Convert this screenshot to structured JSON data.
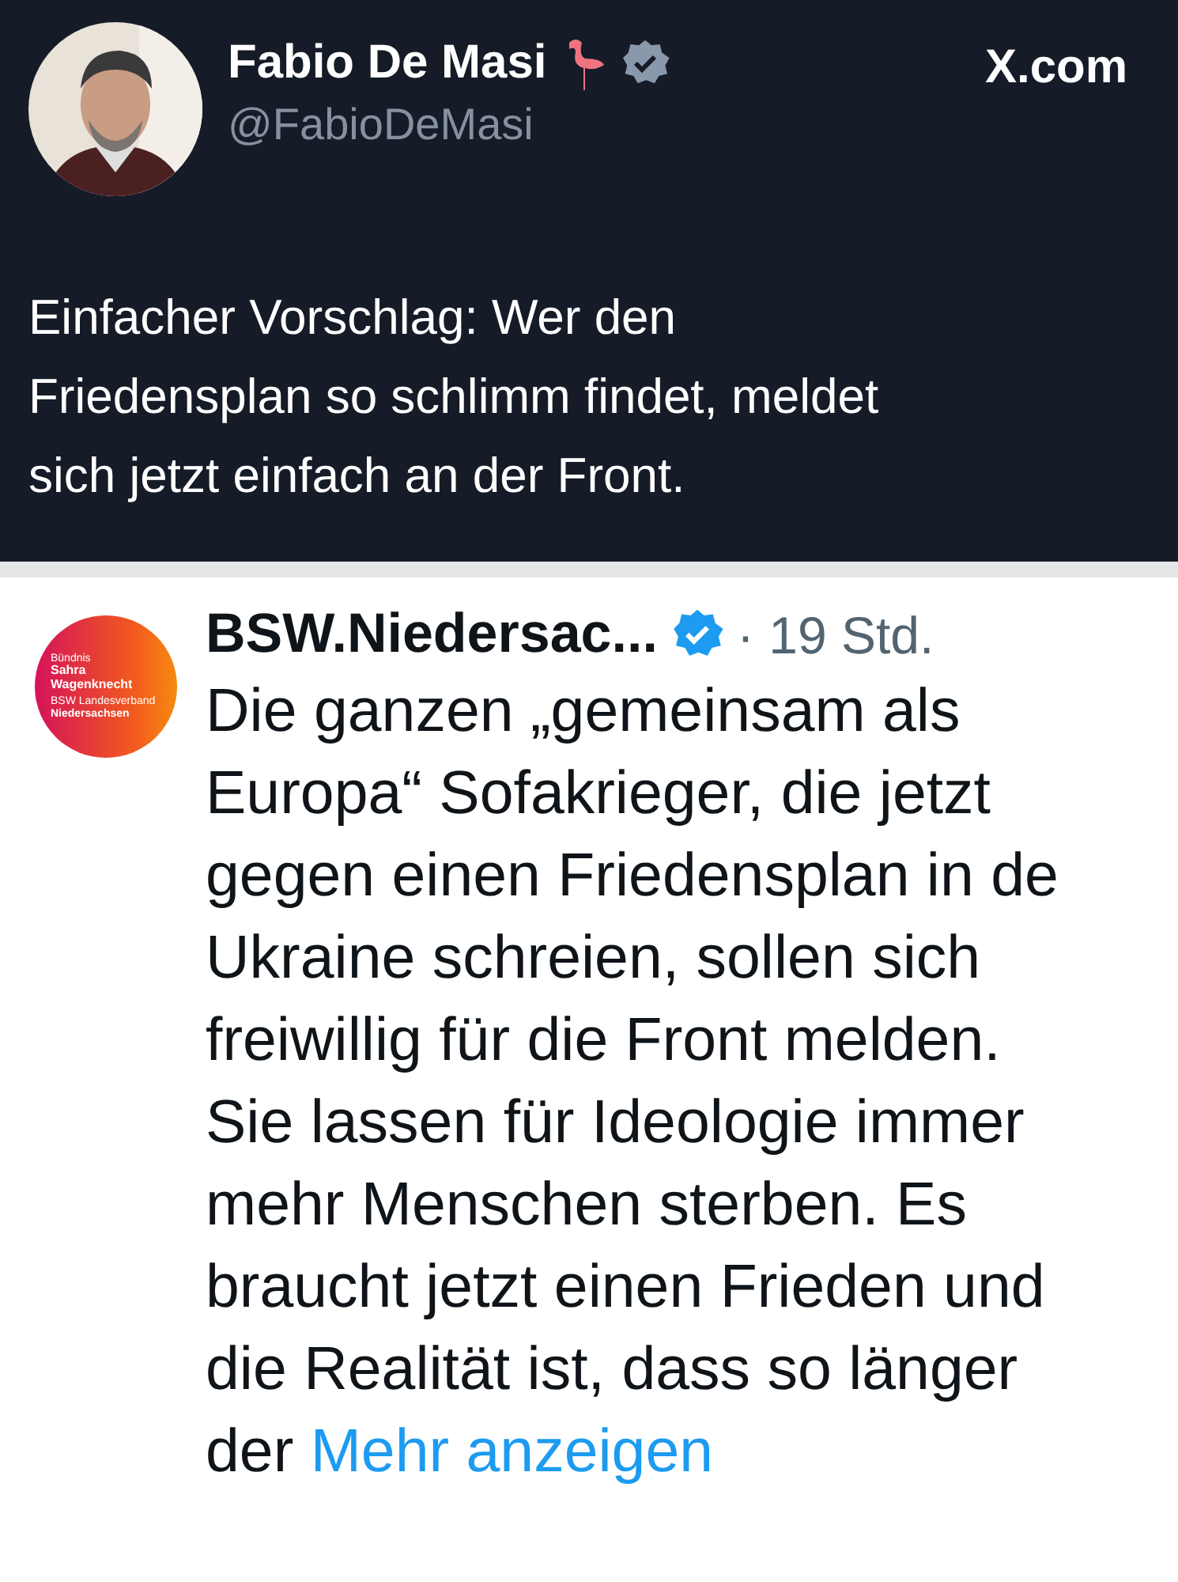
{
  "post": {
    "author": "Fabio De Masi",
    "handle": "@FabioDeMasi",
    "site": "X.com",
    "verified": true,
    "lines": [
      "Einfacher Vorschlag: Wer den",
      "Friedensplan so schlimm findet, meldet",
      "sich jetzt einfach an der Front."
    ]
  },
  "quoted": {
    "author": "BSW.Niedersac...",
    "verified": true,
    "time": "· 19 Std.",
    "logo_lines": [
      "Bündnis",
      "Sahra",
      "Wagenknecht",
      "BSW Landesverband",
      "Niedersachsen"
    ],
    "lines": [
      "Die ganzen „gemeinsam als",
      "Europa“ Sofakrieger, die jetzt",
      "gegen einen Friedensplan in de",
      "Ukraine schreien, sollen sich",
      "freiwillig für die Front melden.",
      "Sie lassen für Ideologie immer",
      "mehr Menschen sterben. Es",
      "braucht jetzt einen Frieden und",
      "die Realität ist, dass so länger",
      "der"
    ],
    "more": "Mehr anzeigen"
  }
}
